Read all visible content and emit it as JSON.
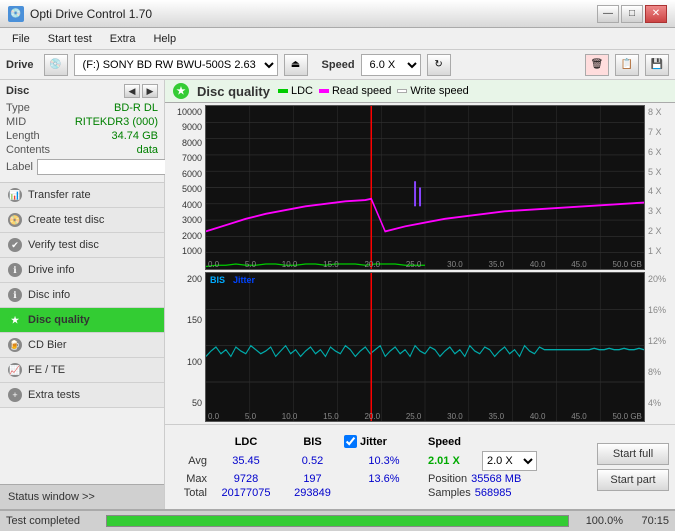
{
  "titlebar": {
    "title": "Opti Drive Control 1.70",
    "icon": "💿",
    "min_btn": "—",
    "max_btn": "□",
    "close_btn": "✕"
  },
  "menubar": {
    "items": [
      "File",
      "Start test",
      "Extra",
      "Help"
    ]
  },
  "drivebar": {
    "label": "Drive",
    "drive_value": "(F:)  SONY BD RW BWU-500S 2.63",
    "speed_label": "Speed",
    "speed_value": "6.0 X"
  },
  "disc": {
    "title": "Disc",
    "type_label": "Type",
    "type_value": "BD-R DL",
    "mid_label": "MID",
    "mid_value": "RITEKDR3 (000)",
    "length_label": "Length",
    "length_value": "34.74 GB",
    "contents_label": "Contents",
    "contents_value": "data",
    "label_label": "Label",
    "label_value": ""
  },
  "nav": {
    "items": [
      {
        "id": "transfer-rate",
        "label": "Transfer rate",
        "active": false
      },
      {
        "id": "create-test-disc",
        "label": "Create test disc",
        "active": false
      },
      {
        "id": "verify-test-disc",
        "label": "Verify test disc",
        "active": false
      },
      {
        "id": "drive-info",
        "label": "Drive info",
        "active": false
      },
      {
        "id": "disc-info",
        "label": "Disc info",
        "active": false
      },
      {
        "id": "disc-quality",
        "label": "Disc quality",
        "active": true
      },
      {
        "id": "cd-bier",
        "label": "CD Bier",
        "active": false
      },
      {
        "id": "fe-te",
        "label": "FE / TE",
        "active": false
      },
      {
        "id": "extra-tests",
        "label": "Extra tests",
        "active": false
      }
    ],
    "status_btn": "Status window >>"
  },
  "chart": {
    "title": "Disc quality",
    "legend": {
      "ldc_color": "#00cc00",
      "ldc_label": "LDC",
      "read_color": "#ff00ff",
      "read_label": "Read speed",
      "write_color": "#ffffff",
      "write_label": "Write speed"
    },
    "top": {
      "y_max": 10000,
      "y_labels": [
        "10000",
        "9000",
        "8000",
        "7000",
        "6000",
        "5000",
        "4000",
        "3000",
        "2000",
        "1000"
      ],
      "x_labels": [
        "0.0",
        "5.0",
        "10.0",
        "15.0",
        "20.0",
        "25.0",
        "30.0",
        "35.0",
        "40.0",
        "45.0",
        "50.0 GB"
      ],
      "right_labels": [
        "8 X",
        "7 X",
        "6 X",
        "5 X",
        "4 X",
        "3 X",
        "2 X",
        "1 X"
      ]
    },
    "bottom": {
      "legend_bis_color": "#00aaff",
      "legend_bis_label": "BIS",
      "legend_jitter_color": "#0044ff",
      "legend_jitter_label": "Jitter",
      "y_labels": [
        "200",
        "150",
        "100",
        "50"
      ],
      "x_labels": [
        "0.0",
        "5.0",
        "10.0",
        "15.0",
        "20.0",
        "25.0",
        "30.0",
        "35.0",
        "40.0",
        "45.0",
        "50.0 GB"
      ],
      "right_labels": [
        "20%",
        "16%",
        "12%",
        "8%",
        "4%"
      ]
    }
  },
  "stats": {
    "ldc_label": "LDC",
    "bis_label": "BIS",
    "jitter_label": "Jitter",
    "speed_label": "Speed",
    "avg_label": "Avg",
    "max_label": "Max",
    "total_label": "Total",
    "avg_ldc": "35.45",
    "avg_bis": "0.52",
    "avg_jitter": "10.3%",
    "max_ldc": "9728",
    "max_bis": "197",
    "max_jitter": "13.6%",
    "total_ldc": "20177075",
    "total_bis": "293849",
    "speed_current": "2.01 X",
    "speed_select": "2.0 X",
    "position_label": "Position",
    "position_value": "35568 MB",
    "samples_label": "Samples",
    "samples_value": "568985",
    "start_full_label": "Start full",
    "start_part_label": "Start part"
  },
  "statusbar": {
    "status_text": "Test completed",
    "progress_pct": 100,
    "progress_display": "100.0%",
    "time": "70:15"
  }
}
